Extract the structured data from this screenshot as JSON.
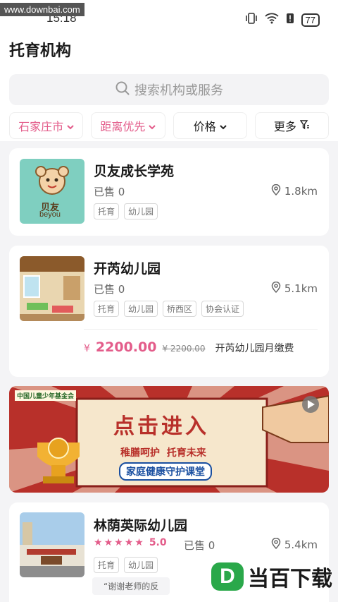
{
  "watermark": "www.downbai.com",
  "status_bar": {
    "time": "15:18",
    "battery": "77"
  },
  "header": {
    "title": "托育机构"
  },
  "search": {
    "placeholder": "搜索机构或服务"
  },
  "filters": [
    {
      "label": "石家庄市",
      "active": true
    },
    {
      "label": "距离优先",
      "active": true
    },
    {
      "label": "价格",
      "active": false
    },
    {
      "label": "更多",
      "active": false
    }
  ],
  "cards": [
    {
      "name": "贝友成长学苑",
      "sold": "已售 0",
      "distance": "1.8km",
      "tags": [
        "托育",
        "幼儿园"
      ],
      "logo_text": "贝友",
      "logo_sub": "beyou"
    },
    {
      "name": "开芮幼儿园",
      "sold": "已售 0",
      "distance": "5.1km",
      "tags": [
        "托育",
        "幼儿园",
        "桥西区",
        "协会认证"
      ],
      "price_symbol": "¥",
      "price": "2200.00",
      "original_price": "¥ 2200.00",
      "service": "开芮幼儿园月缴费"
    },
    {
      "name": "林荫英际幼儿园",
      "rating": "5.0",
      "rating_stars": 5,
      "sold": "已售 0",
      "distance": "5.4km",
      "tags": [
        "托育",
        "幼儿园"
      ],
      "comment": "“谢谢老师的反"
    }
  ],
  "banner": {
    "org": "中国儿童少年基金会",
    "title_chars": [
      "点",
      "击",
      "进",
      "入"
    ],
    "slogan": "稚膳呵护  托育未来",
    "subtitle": "家庭健康守护课堂"
  },
  "bottom_watermark": {
    "text": "当百下载",
    "letter": "D"
  },
  "colors": {
    "accent": "#e35c8a",
    "banner_red": "#b8302a",
    "banner_cream": "#f6e7cc",
    "teal": "#7fcfc0"
  }
}
